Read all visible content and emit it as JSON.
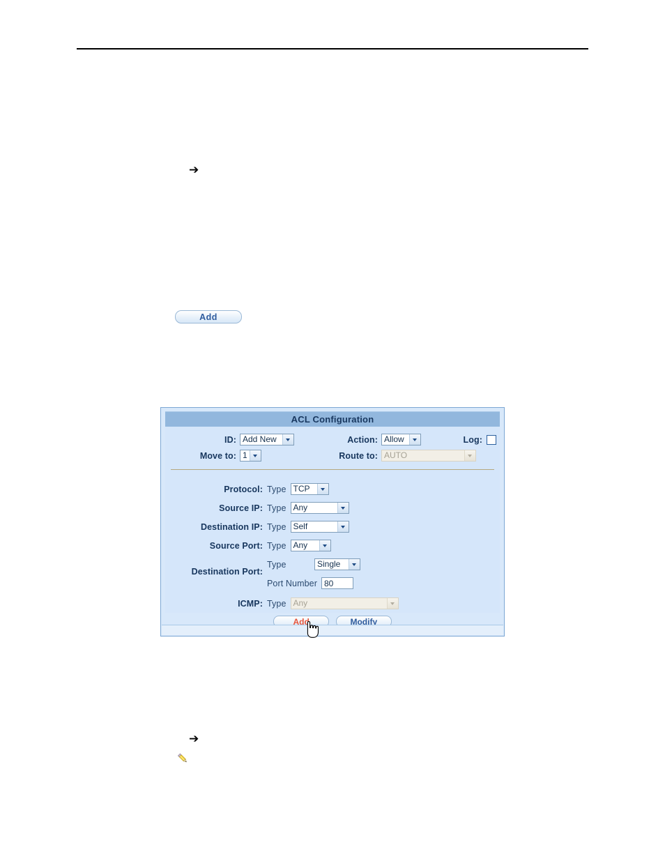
{
  "page": {
    "markers": {
      "arrow_1": "➔",
      "arrow_2": "➔"
    },
    "standalone_button": {
      "label": "Add"
    },
    "icons": {
      "pencil": "pencil-note-icon",
      "cursor": "hand-cursor"
    }
  },
  "panel": {
    "title": "ACL Configuration",
    "rows": {
      "id": {
        "label": "ID:",
        "value": "Add New"
      },
      "action": {
        "label": "Action:",
        "value": "Allow"
      },
      "log": {
        "label": "Log:",
        "checked": false
      },
      "move_to": {
        "label": "Move to:",
        "value": "1"
      },
      "route_to": {
        "label": "Route to:",
        "value": "AUTO",
        "disabled": true
      },
      "protocol": {
        "label": "Protocol:",
        "type_label": "Type",
        "value": "TCP"
      },
      "source_ip": {
        "label": "Source IP:",
        "type_label": "Type",
        "value": "Any"
      },
      "destination_ip": {
        "label": "Destination IP:",
        "type_label": "Type",
        "value": "Self"
      },
      "source_port": {
        "label": "Source Port:",
        "type_label": "Type",
        "value": "Any"
      },
      "destination_port": {
        "label": "Destination Port:",
        "type_label": "Type",
        "type_value": "Single",
        "port_number_label": "Port Number",
        "port_number_value": "80"
      },
      "icmp": {
        "label": "ICMP:",
        "type_label": "Type",
        "value": "Any",
        "disabled": true
      }
    },
    "buttons": {
      "add": "Add",
      "modify": "Modify"
    }
  },
  "colors": {
    "panel_border": "#7ca7d4",
    "titlebar_bg": "#92b7dd",
    "panel_bg": "#d5e6fa",
    "label_text": "#17365d",
    "button_text": "#2f5c9e",
    "button_hover_text": "#e8563c",
    "separator": "#b5a87f",
    "disabled_field_bg": "#f2efe6"
  }
}
